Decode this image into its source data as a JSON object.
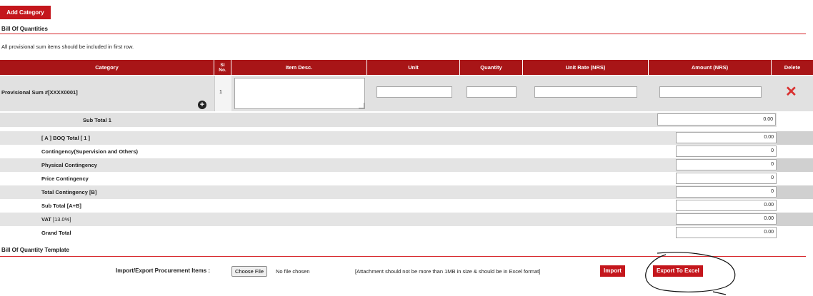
{
  "add_category_label": "Add Category",
  "boq_section": {
    "title": "Bill Of Quantities",
    "note": "All provisional sum items should be included in first row."
  },
  "table": {
    "headers": {
      "category": "Category",
      "sl_no": "Sl No.",
      "item_desc": "Item Desc.",
      "unit": "Unit",
      "quantity": "Quantity",
      "unit_rate": "Unit Rate (NRS)",
      "amount": "Amount (NRS)",
      "delete": "Delete"
    },
    "row": {
      "category": "Provisional Sum #[XXXX0001]",
      "sl_no": "1",
      "item_desc": "",
      "unit": "",
      "quantity": "",
      "unit_rate": "",
      "amount": ""
    },
    "subtotal_label": "Sub Total 1",
    "subtotal_value": "0.00"
  },
  "summary": [
    {
      "label": "[ A ] BOQ Total [ 1 ]",
      "value": "0.00"
    },
    {
      "label": "Contingency(Supervision and Others)",
      "value": "0"
    },
    {
      "label": "Physical Contingency",
      "value": "0"
    },
    {
      "label": "Price Contingency",
      "value": "0"
    },
    {
      "label": "Total Contingency [B]",
      "value": "0"
    },
    {
      "label": "Sub Total [A+B]",
      "value": "0.00"
    },
    {
      "label": "VAT",
      "suffix": "[13.0%]",
      "value": "0.00"
    },
    {
      "label": "Grand Total",
      "value": "0.00"
    }
  ],
  "template_section": {
    "title": "Bill Of Quantity Template",
    "import_label": "Import/Export Procurement Items :",
    "choose_file_label": "Choose File",
    "no_file_text": "No file chosen",
    "attachment_note": "[Attachment should not be more than 1MB in size & should be in Excel format]",
    "import_button": "Import",
    "export_button": "Export To Excel"
  },
  "colors": {
    "brand_red": "#c4161c",
    "header_red": "#a81517",
    "delete_x": "#d9302f"
  },
  "icons": {
    "add_row": "plus-circle-icon",
    "delete_row": "cross-icon"
  }
}
